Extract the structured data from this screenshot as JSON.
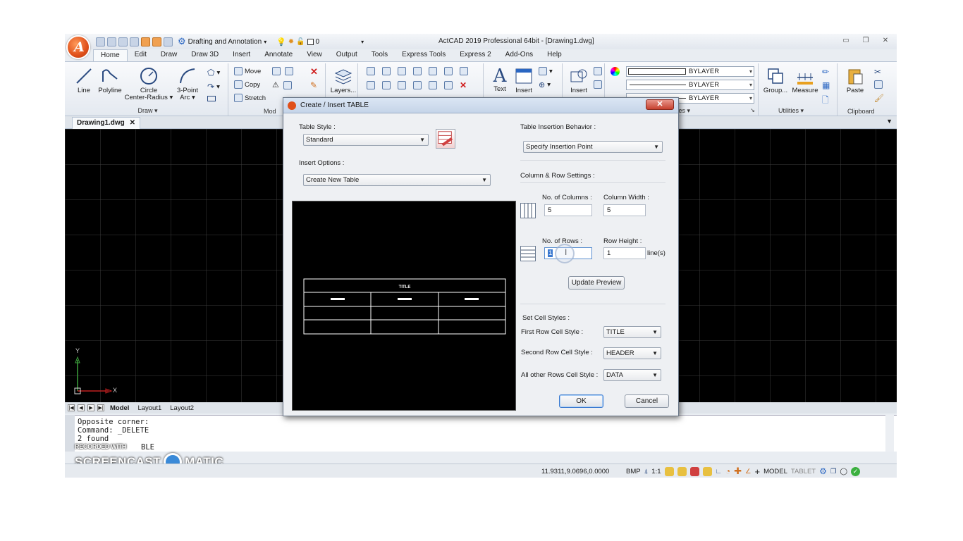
{
  "titlebar": {
    "workspace": "Drafting and Annotation",
    "layer_value": "0",
    "title": "ActCAD 2019 Professional 64bit - [Drawing1.dwg]"
  },
  "menu_tabs": [
    "Home",
    "Edit",
    "Draw",
    "Draw 3D",
    "Insert",
    "Annotate",
    "View",
    "Output",
    "Tools",
    "Express Tools",
    "Express 2",
    "Add-Ons",
    "Help"
  ],
  "ribbon": {
    "draw": {
      "line": "Line",
      "polyline": "Polyline",
      "circle": "Circle",
      "circle_sub": "Center-Radius",
      "arc": "3-Point",
      "arc_sub": "Arc",
      "panel": "Draw"
    },
    "modify": {
      "move": "Move",
      "copy": "Copy",
      "stretch": "Stretch",
      "panel": "Mod"
    },
    "layers": "Layers...",
    "annotation": {
      "text": "Text",
      "insert": "Insert"
    },
    "block_insert": "Insert",
    "properties": {
      "bylayer_1": "BYLAYER",
      "bylayer_2": "BYLAYER",
      "bylayer_3": "BYLAYER",
      "panel": "ties"
    },
    "utilities": {
      "group": "Group...",
      "measure": "Measure",
      "panel": "Utilities"
    },
    "clipboard": {
      "paste": "Paste",
      "panel": "Clipboard"
    }
  },
  "document_tab": "Drawing1.dwg",
  "ucs": {
    "y": "Y",
    "x": "X"
  },
  "layout_tabs": [
    "Model",
    "Layout1",
    "Layout2"
  ],
  "command_lines": [
    "Opposite corner:",
    "Command: _DELETE",
    "2 found"
  ],
  "command_tail": "BLE",
  "watermark": {
    "top": "RECORDED WITH",
    "left": "SCREENCAST",
    "right": "MATIC"
  },
  "status": {
    "coords": "11.9311,9.0696,0.0000",
    "bmp": "BMP",
    "scale": "1:1",
    "model": "MODEL",
    "tablet": "TABLET"
  },
  "dialog": {
    "title": "Create / Insert TABLE",
    "table_style_label": "Table Style :",
    "table_style_value": "Standard",
    "insert_options_label": "Insert Options :",
    "insert_options_value": "Create New Table",
    "preview": {
      "title": "TITLE"
    },
    "insertion_behavior_label": "Table Insertion Behavior :",
    "insertion_behavior_value": "Specify Insertion Point",
    "col_row_settings_label": "Column & Row Settings :",
    "num_columns_label": "No. of Columns :",
    "num_columns_value": "5",
    "column_width_label": "Column Width :",
    "column_width_value": "5",
    "num_rows_label": "No. of Rows :",
    "num_rows_value": "1",
    "row_height_label": "Row Height :",
    "row_height_value": "1",
    "lines_unit": "line(s)",
    "update_preview": "Update Preview",
    "cell_styles_label": "Set Cell Styles :",
    "first_row_label": "First Row Cell Style :",
    "first_row_value": "TITLE",
    "second_row_label": "Second Row Cell Style :",
    "second_row_value": "HEADER",
    "other_rows_label": "All other Rows Cell Style :",
    "other_rows_value": "DATA",
    "ok": "OK",
    "cancel": "Cancel"
  }
}
